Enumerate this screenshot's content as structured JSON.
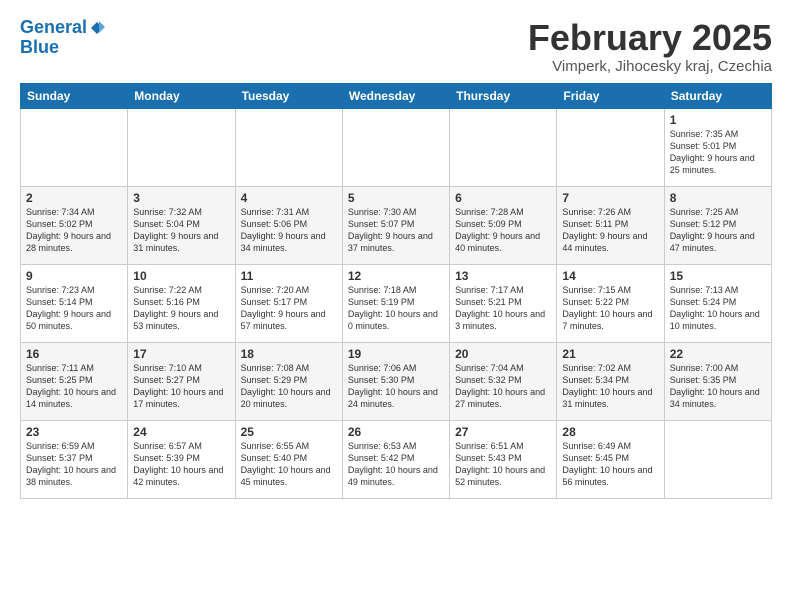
{
  "header": {
    "logo_line1": "General",
    "logo_line2": "Blue",
    "month_title": "February 2025",
    "subtitle": "Vimperk, Jihocesky kraj, Czechia"
  },
  "days_of_week": [
    "Sunday",
    "Monday",
    "Tuesday",
    "Wednesday",
    "Thursday",
    "Friday",
    "Saturday"
  ],
  "rows": [
    {
      "alt": false,
      "cells": [
        {
          "day": "",
          "info": ""
        },
        {
          "day": "",
          "info": ""
        },
        {
          "day": "",
          "info": ""
        },
        {
          "day": "",
          "info": ""
        },
        {
          "day": "",
          "info": ""
        },
        {
          "day": "",
          "info": ""
        },
        {
          "day": "1",
          "info": "Sunrise: 7:35 AM\nSunset: 5:01 PM\nDaylight: 9 hours and 25 minutes."
        }
      ]
    },
    {
      "alt": true,
      "cells": [
        {
          "day": "2",
          "info": "Sunrise: 7:34 AM\nSunset: 5:02 PM\nDaylight: 9 hours and 28 minutes."
        },
        {
          "day": "3",
          "info": "Sunrise: 7:32 AM\nSunset: 5:04 PM\nDaylight: 9 hours and 31 minutes."
        },
        {
          "day": "4",
          "info": "Sunrise: 7:31 AM\nSunset: 5:06 PM\nDaylight: 9 hours and 34 minutes."
        },
        {
          "day": "5",
          "info": "Sunrise: 7:30 AM\nSunset: 5:07 PM\nDaylight: 9 hours and 37 minutes."
        },
        {
          "day": "6",
          "info": "Sunrise: 7:28 AM\nSunset: 5:09 PM\nDaylight: 9 hours and 40 minutes."
        },
        {
          "day": "7",
          "info": "Sunrise: 7:26 AM\nSunset: 5:11 PM\nDaylight: 9 hours and 44 minutes."
        },
        {
          "day": "8",
          "info": "Sunrise: 7:25 AM\nSunset: 5:12 PM\nDaylight: 9 hours and 47 minutes."
        }
      ]
    },
    {
      "alt": false,
      "cells": [
        {
          "day": "9",
          "info": "Sunrise: 7:23 AM\nSunset: 5:14 PM\nDaylight: 9 hours and 50 minutes."
        },
        {
          "day": "10",
          "info": "Sunrise: 7:22 AM\nSunset: 5:16 PM\nDaylight: 9 hours and 53 minutes."
        },
        {
          "day": "11",
          "info": "Sunrise: 7:20 AM\nSunset: 5:17 PM\nDaylight: 9 hours and 57 minutes."
        },
        {
          "day": "12",
          "info": "Sunrise: 7:18 AM\nSunset: 5:19 PM\nDaylight: 10 hours and 0 minutes."
        },
        {
          "day": "13",
          "info": "Sunrise: 7:17 AM\nSunset: 5:21 PM\nDaylight: 10 hours and 3 minutes."
        },
        {
          "day": "14",
          "info": "Sunrise: 7:15 AM\nSunset: 5:22 PM\nDaylight: 10 hours and 7 minutes."
        },
        {
          "day": "15",
          "info": "Sunrise: 7:13 AM\nSunset: 5:24 PM\nDaylight: 10 hours and 10 minutes."
        }
      ]
    },
    {
      "alt": true,
      "cells": [
        {
          "day": "16",
          "info": "Sunrise: 7:11 AM\nSunset: 5:25 PM\nDaylight: 10 hours and 14 minutes."
        },
        {
          "day": "17",
          "info": "Sunrise: 7:10 AM\nSunset: 5:27 PM\nDaylight: 10 hours and 17 minutes."
        },
        {
          "day": "18",
          "info": "Sunrise: 7:08 AM\nSunset: 5:29 PM\nDaylight: 10 hours and 20 minutes."
        },
        {
          "day": "19",
          "info": "Sunrise: 7:06 AM\nSunset: 5:30 PM\nDaylight: 10 hours and 24 minutes."
        },
        {
          "day": "20",
          "info": "Sunrise: 7:04 AM\nSunset: 5:32 PM\nDaylight: 10 hours and 27 minutes."
        },
        {
          "day": "21",
          "info": "Sunrise: 7:02 AM\nSunset: 5:34 PM\nDaylight: 10 hours and 31 minutes."
        },
        {
          "day": "22",
          "info": "Sunrise: 7:00 AM\nSunset: 5:35 PM\nDaylight: 10 hours and 34 minutes."
        }
      ]
    },
    {
      "alt": false,
      "cells": [
        {
          "day": "23",
          "info": "Sunrise: 6:59 AM\nSunset: 5:37 PM\nDaylight: 10 hours and 38 minutes."
        },
        {
          "day": "24",
          "info": "Sunrise: 6:57 AM\nSunset: 5:39 PM\nDaylight: 10 hours and 42 minutes."
        },
        {
          "day": "25",
          "info": "Sunrise: 6:55 AM\nSunset: 5:40 PM\nDaylight: 10 hours and 45 minutes."
        },
        {
          "day": "26",
          "info": "Sunrise: 6:53 AM\nSunset: 5:42 PM\nDaylight: 10 hours and 49 minutes."
        },
        {
          "day": "27",
          "info": "Sunrise: 6:51 AM\nSunset: 5:43 PM\nDaylight: 10 hours and 52 minutes."
        },
        {
          "day": "28",
          "info": "Sunrise: 6:49 AM\nSunset: 5:45 PM\nDaylight: 10 hours and 56 minutes."
        },
        {
          "day": "",
          "info": ""
        }
      ]
    }
  ]
}
